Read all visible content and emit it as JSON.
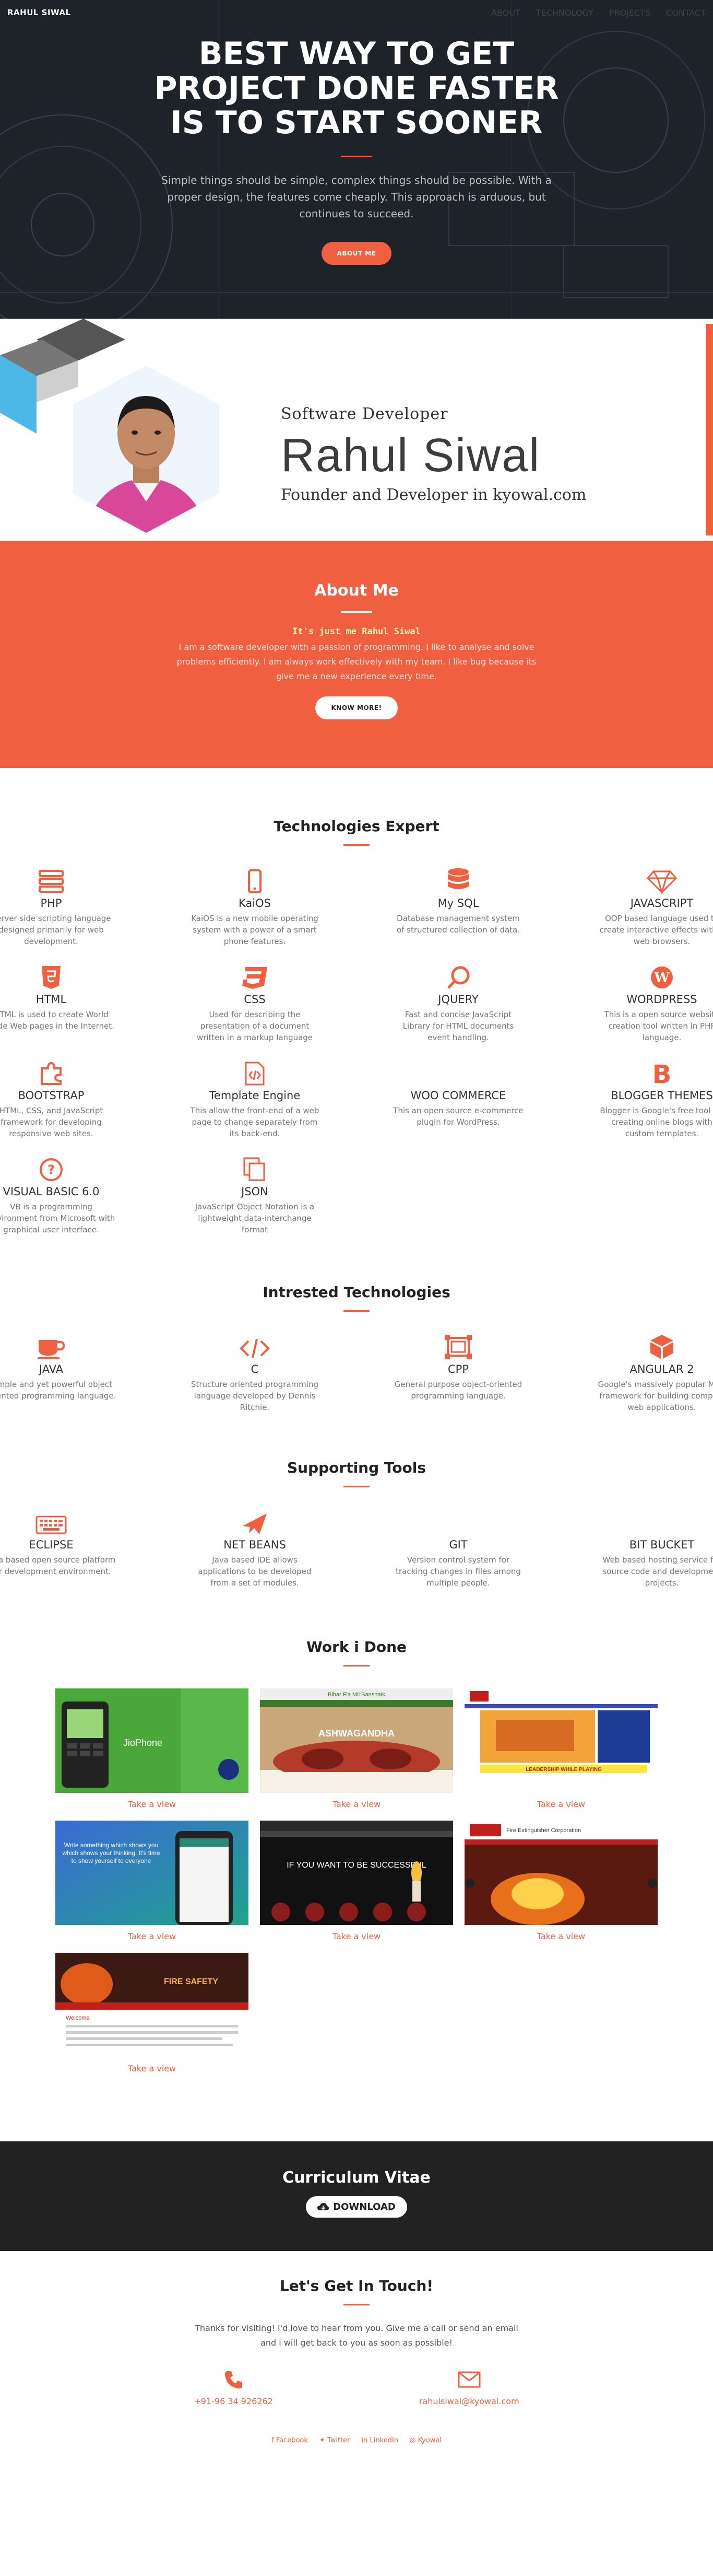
{
  "nav": {
    "brand": "RAHUL SIWAL",
    "links": [
      "ABOUT",
      "TECHNOLOGY",
      "PROJECTS",
      "CONTACT"
    ]
  },
  "hero": {
    "title": "BEST WAY TO GET PROJECT DONE FASTER IS TO START SOONER",
    "subtitle": "Simple things should be simple, complex things should be possible. With a proper design, the features come cheaply. This approach is arduous, but continues to succeed.",
    "button": "ABOUT ME"
  },
  "profile": {
    "role": "Software Developer",
    "name": "Rahul Siwal",
    "tagline": "Founder and Developer in kyowal.com"
  },
  "about": {
    "title": "About Me",
    "lead": "It's just me Rahul Siwal",
    "text": "I am a software developer with a passion of programming. I like to analyse and solve problems efficiently. I am always work effectively with my team. I like bug because its give me a new experience every time.",
    "button": "KNOW MORE!"
  },
  "technologies": {
    "title": "Technologies Expert",
    "items": [
      {
        "name": "PHP",
        "desc": "Server side scripting language designed primarily for web development.",
        "icon": "server-icon"
      },
      {
        "name": "KaiOS",
        "desc": "KaiOS is a new mobile operating system with a power of a smart phone features.",
        "icon": "mobile-icon"
      },
      {
        "name": "My SQL",
        "desc": "Database management system of structured collection of data.",
        "icon": "database-icon"
      },
      {
        "name": "JAVASCRIPT",
        "desc": "OOP based language used to create interactive effects within web browsers.",
        "icon": "diamond-icon"
      },
      {
        "name": "HTML",
        "desc": "HTML is used to create World Wide Web pages in the Internet.",
        "icon": "html5-icon"
      },
      {
        "name": "CSS",
        "desc": "Used for describing the presentation of a document written in a markup language",
        "icon": "css3-icon"
      },
      {
        "name": "JQUERY",
        "desc": "Fast and concise JavaScript Library for HTML documents event handling.",
        "icon": "ring-icon"
      },
      {
        "name": "WORDPRESS",
        "desc": "This is a open source website creation tool written in PHP language.",
        "icon": "wordpress-icon"
      },
      {
        "name": "BOOTSTRAP",
        "desc": "HTML, CSS, and JavaScript framework for developing responsive web sites.",
        "icon": "puzzle-icon"
      },
      {
        "name": "Template Engine",
        "desc": "This allow the front-end of a web page to change separately from its back-end.",
        "icon": "code-file-icon"
      },
      {
        "name": "WOO COMMERCE",
        "desc": "This an open source e-commerce plugin for WordPress.",
        "icon": "woo-icon"
      },
      {
        "name": "BLOGGER THEMES",
        "desc": "Blogger is Google's free tool for creating online blogs with custom templates.",
        "icon": "blogger-icon"
      },
      {
        "name": "VISUAL BASIC 6.0",
        "desc": "VB is a programming environment from Microsoft with graphical user interface.",
        "icon": "question-icon"
      },
      {
        "name": "JSON",
        "desc": "JavaScript Object Notation is a lightweight data-interchange format",
        "icon": "copy-icon"
      }
    ]
  },
  "interested": {
    "title": "Intrested Technologies",
    "items": [
      {
        "name": "JAVA",
        "desc": "Simple and yet powerful object oriented programming language.",
        "icon": "coffee-icon"
      },
      {
        "name": "C",
        "desc": "Structure oriented programming language developed by Dennis Ritchie.",
        "icon": "code-icon"
      },
      {
        "name": "CPP",
        "desc": "General purpose object-oriented programming language.",
        "icon": "frame-icon"
      },
      {
        "name": "ANGULAR 2",
        "desc": "Google's massively popular MVC framework for building complex web applications.",
        "icon": "cube-icon"
      }
    ]
  },
  "tools": {
    "title": "Supporting Tools",
    "items": [
      {
        "name": "ECLIPSE",
        "desc": "Java based open source platform for development environment.",
        "icon": "keyboard-icon"
      },
      {
        "name": "NET BEANS",
        "desc": "Java based IDE allows applications to be developed from a set of modules.",
        "icon": "plane-icon"
      },
      {
        "name": "GIT",
        "desc": "Version control system for tracking changes in files among multiple people.",
        "icon": "none"
      },
      {
        "name": "BIT BUCKET",
        "desc": "Web based hosting service for source code and development projects.",
        "icon": "none"
      }
    ]
  },
  "work": {
    "title": "Work i Done",
    "view_label": "Take a view",
    "items": [
      {
        "caption": "Take a view",
        "image_text": "JioPhone"
      },
      {
        "caption": "Take a view",
        "image_text": "Bihar Fla Mil Sanshatk"
      },
      {
        "caption": "Take a view",
        "image_text": "LEADERSHIP WHILE PLAYING"
      },
      {
        "caption": "Take a view",
        "image_text": "Write something which shows you which shows your thinking. It's time to show yourself to everyone"
      },
      {
        "caption": "Take a view",
        "image_text": "IF YOU WANT TO BE SUCCESSFUL"
      },
      {
        "caption": "Take a view",
        "image_text": "Fire Extinguisher Corporation"
      },
      {
        "caption": "Take a view",
        "image_text": "Welcome"
      }
    ]
  },
  "cv": {
    "title": "Curriculum Vitae",
    "button": "DOWNLOAD"
  },
  "contact": {
    "title": "Let's Get In Touch!",
    "text": "Thanks for visiting! I'd love to hear from you. Give me a call or send an email and i will get back to you as soon as possible!",
    "phone": "+91-96 34 926262",
    "email": "rahulsiwal@kyowal.com",
    "social": [
      "Facebook",
      "Twitter",
      "LinkedIn",
      "Kyowal"
    ]
  },
  "colors": {
    "accent": "#f05f40",
    "dark": "#222222"
  }
}
